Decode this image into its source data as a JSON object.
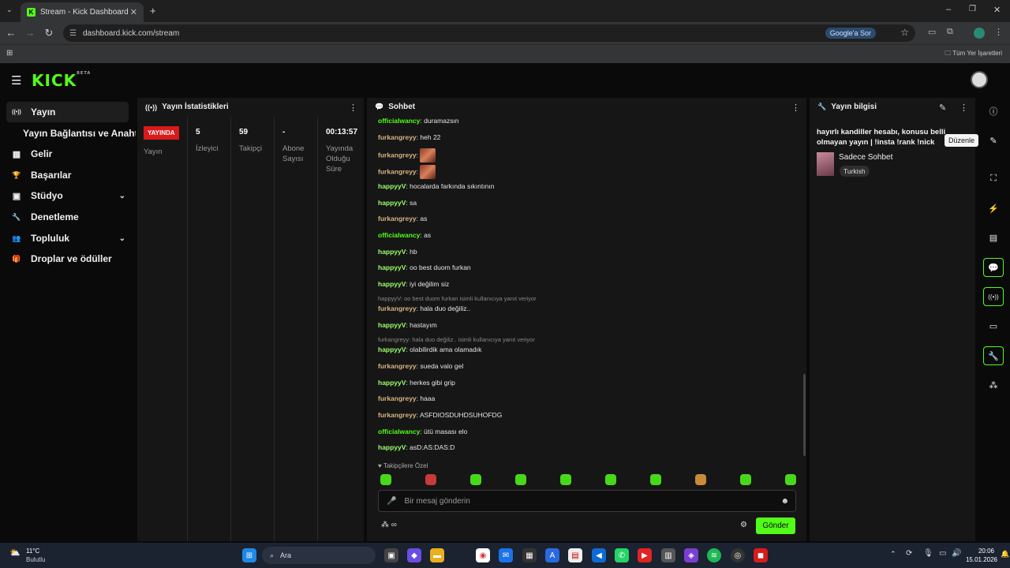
{
  "browser": {
    "tab_title": "Stream - Kick Dashboard",
    "tab_favicon": "K",
    "tab_close": "✕",
    "new_tab": "+",
    "url": "dashboard.kick.com/stream",
    "google_button": "Google'a Sor",
    "bookmarks_label": "Tüm Yer İşaretleri",
    "window_controls": [
      "–",
      "❐",
      "✕"
    ]
  },
  "app": {
    "logo": "KICK",
    "logo_beta": "BETA",
    "sidebar": [
      {
        "label": "Yayın",
        "icon": "broadcast-icon",
        "glyph": "((•))",
        "active": true
      },
      {
        "label": "Yayın Bağlantısı ve Anahtarı",
        "sub": true
      },
      {
        "label": "Gelir",
        "icon": "chart-icon",
        "glyph": "▦"
      },
      {
        "label": "Başarılar",
        "icon": "trophy-icon",
        "glyph": "🏆"
      },
      {
        "label": "Stüdyo",
        "icon": "studio-icon",
        "glyph": "▣",
        "chevron": "⌄"
      },
      {
        "label": "Denetleme",
        "icon": "wrench-icon",
        "glyph": "🔧"
      },
      {
        "label": "Topluluk",
        "icon": "people-icon",
        "glyph": "👥",
        "chevron": "⌄"
      },
      {
        "label": "Droplar ve ödüller",
        "icon": "gift-icon",
        "glyph": "🎁"
      }
    ]
  },
  "stats_panel": {
    "title": "Yayın İstatistikleri",
    "live_badge": "YAYINDA",
    "live_label": "Yayın",
    "items": [
      {
        "value": "5",
        "label": "İzleyici"
      },
      {
        "value": "59",
        "label": "Takipçi"
      },
      {
        "value": "-",
        "label": "Abone Sayısı"
      },
      {
        "value": "00:13:57",
        "label": "Yayında Olduğu Süre"
      }
    ]
  },
  "chat_panel": {
    "title": "Sohbet",
    "messages": [
      {
        "user": "officialwancy",
        "color": "green",
        "text": "duramazsın"
      },
      {
        "user": "furkangreyy",
        "color": "tan",
        "text": "heh 22"
      },
      {
        "user": "furkangreyy",
        "color": "tan",
        "text": "",
        "emote": true
      },
      {
        "user": "furkangreyy",
        "color": "tan",
        "text": "",
        "emote": true
      },
      {
        "user": "happyyV",
        "color": "lime",
        "text": "hocalarda farkında sıkıntının"
      },
      {
        "user": "happyyV",
        "color": "lime",
        "text": "sa"
      },
      {
        "user": "furkangreyy",
        "color": "tan",
        "text": "as"
      },
      {
        "user": "officialwancy",
        "color": "green",
        "text": "as"
      },
      {
        "user": "happyyV",
        "color": "lime",
        "text": "hb"
      },
      {
        "user": "happyyV",
        "color": "lime",
        "text": "oo best duom furkan"
      },
      {
        "user": "happyyV",
        "color": "lime",
        "text": "iyi değilim siz"
      },
      {
        "reply": "happyyV: oo best duom furkan isimli kullanıcıya yanıt veriyor"
      },
      {
        "user": "furkangreyy",
        "color": "tan",
        "text": "hala duo değiliz.."
      },
      {
        "user": "happyyV",
        "color": "lime",
        "text": "hastayım"
      },
      {
        "reply": "furkangreyy: hala duo değiliz.. isimli kullanıcıya yanıt veriyor"
      },
      {
        "user": "happyyV",
        "color": "lime",
        "text": "olabilirdik ama olamadık"
      },
      {
        "user": "furkangreyy",
        "color": "tan",
        "text": "sueda valo gel"
      },
      {
        "user": "happyyV",
        "color": "lime",
        "text": "herkes gibi grip"
      },
      {
        "user": "furkangreyy",
        "color": "tan",
        "text": "haaa"
      },
      {
        "user": "furkangreyy",
        "color": "tan",
        "text": "ASFDIOSDUHDSUHOFDG"
      },
      {
        "user": "officialwancy",
        "color": "green",
        "text": "ütü masası elo"
      },
      {
        "user": "happyyV",
        "color": "lime",
        "text": "asD:AS:DAS:D"
      }
    ],
    "follower_label": "♥ Takipçilere Özel",
    "input_placeholder": "Bir mesaj gönderin",
    "send_label": "Gönder"
  },
  "info_panel": {
    "title": "Yayın bilgisi",
    "stream_title": "hayırlı kandiller hesabı, konusu belli olmayan yayın | !insta !rank !nick",
    "category": "Sadece Sohbet",
    "tag": "Turkish",
    "tooltip": "Düzenle"
  },
  "taskbar": {
    "weather_temp": "11°C",
    "weather_desc": "Bulutlu",
    "search": "Ara",
    "time": "20:06",
    "date": "15.01.2026"
  },
  "colors": {
    "accent": "#53fc18",
    "live": "#d91a1a"
  }
}
